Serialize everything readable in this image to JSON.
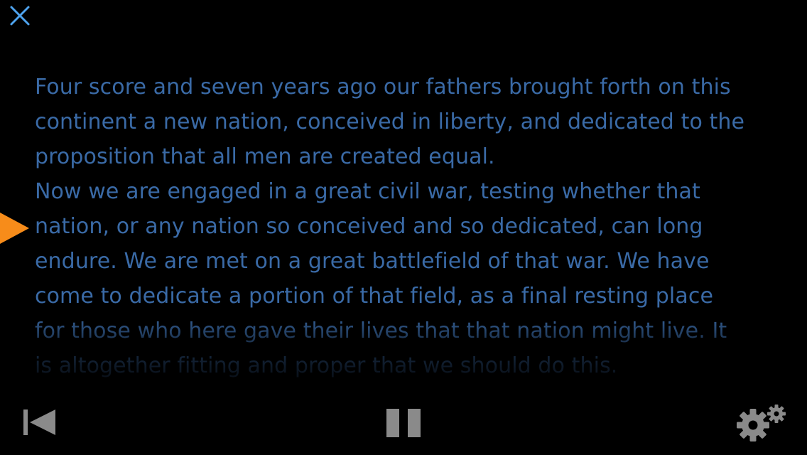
{
  "colors": {
    "background": "#000000",
    "accent_icon": "#4ea3ee",
    "prompt_text": "#3a6aa6",
    "marker": "#f78c1a",
    "controls": "#8a8a8a"
  },
  "toolbar_top": {
    "close_icon": "close-icon"
  },
  "reading_marker_icon": "triangle-right-icon",
  "prompt": {
    "lines": [
      "Four score and seven years ago our fathers brought forth on this",
      "continent a new nation, conceived in liberty, and dedicated to the",
      "proposition that all men are created equal.",
      "Now we are engaged in a great civil war, testing whether that",
      "nation, or any nation so conceived and so dedicated, can long",
      "endure. We are met on a great battlefield of that war. We have",
      "come to dedicate a portion of that field, as a final resting place",
      "for those who here gave their lives that that nation might live. It",
      "is altogether fitting and proper that we should do this."
    ]
  },
  "controls": {
    "rewind_icon": "skip-back-icon",
    "pause_icon": "pause-icon",
    "settings_icon": "gears-icon"
  }
}
